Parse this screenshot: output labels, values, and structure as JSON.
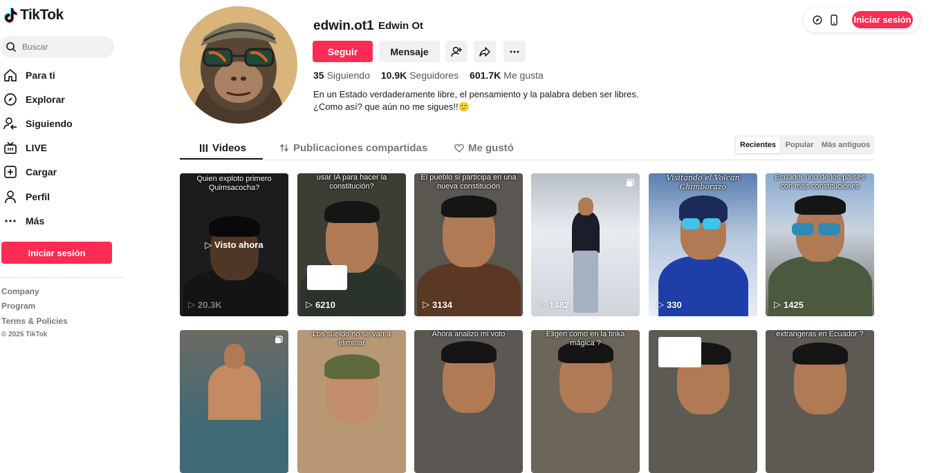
{
  "brand": {
    "name": "TikTok"
  },
  "search": {
    "placeholder": "Buscar"
  },
  "nav": [
    {
      "label": "Para ti",
      "icon": "home-icon"
    },
    {
      "label": "Explorar",
      "icon": "compass-icon"
    },
    {
      "label": "Siguiendo",
      "icon": "following-icon"
    },
    {
      "label": "LIVE",
      "icon": "live-icon"
    },
    {
      "label": "Cargar",
      "icon": "upload-icon"
    },
    {
      "label": "Perfil",
      "icon": "profile-icon"
    },
    {
      "label": "Más",
      "icon": "more-icon"
    }
  ],
  "sidebar_login": "Iniciar sesión",
  "footer": {
    "company": "Company",
    "program": "Program",
    "terms": "Terms & Policies",
    "copyright": "© 2025 TikTok"
  },
  "topbar": {
    "login": "Iniciar sesión"
  },
  "profile": {
    "username": "edwin.ot1",
    "nickname": "Edwin Ot",
    "follow": "Seguir",
    "message": "Mensaje",
    "following_count": "35",
    "following_label": "Siguiendo",
    "followers_count": "10.9K",
    "followers_label": "Seguidores",
    "likes_count": "601.7K",
    "likes_label": "Me gusta",
    "bio_line1": "En un Estado verdaderamente libre, el pensamiento y la palabra deben ser libres.",
    "bio_line2": "¿Como así? que aún no me sigues!!🙂"
  },
  "tabs": {
    "videos": "Videos",
    "shared": "Publicaciones compartidas",
    "liked": "Me gustó"
  },
  "sort": {
    "recent": "Recientes",
    "popular": "Popular",
    "oldest": "Más antiguos"
  },
  "videos": [
    {
      "caption": "Quien exploto primero Quimsacocha?",
      "views": "20.3K",
      "watched": "Visto ahora"
    },
    {
      "caption": "usar IA para hacer la constitución?",
      "views": "6210"
    },
    {
      "caption": "El pueblo si participa en una nueva constitución",
      "views": "3134"
    },
    {
      "caption": "",
      "views": "1482"
    },
    {
      "caption": "Visitando el Volcan Chimborazo",
      "views": "330"
    },
    {
      "caption": "Ecuador uno de los países con más constituciones",
      "views": "1425"
    },
    {
      "caption": "",
      "views": ""
    },
    {
      "caption": "Los sueldo no se van a eliminar",
      "views": ""
    },
    {
      "caption": "Ahora analizo mi voto",
      "views": ""
    },
    {
      "caption": "Eligen como en la tinka mágica ?",
      "views": ""
    },
    {
      "caption": "",
      "views": ""
    },
    {
      "caption": "extrangeras en Ecuador ?",
      "views": ""
    }
  ],
  "colors": {
    "accent": "#fe2c55",
    "text": "#161823"
  }
}
